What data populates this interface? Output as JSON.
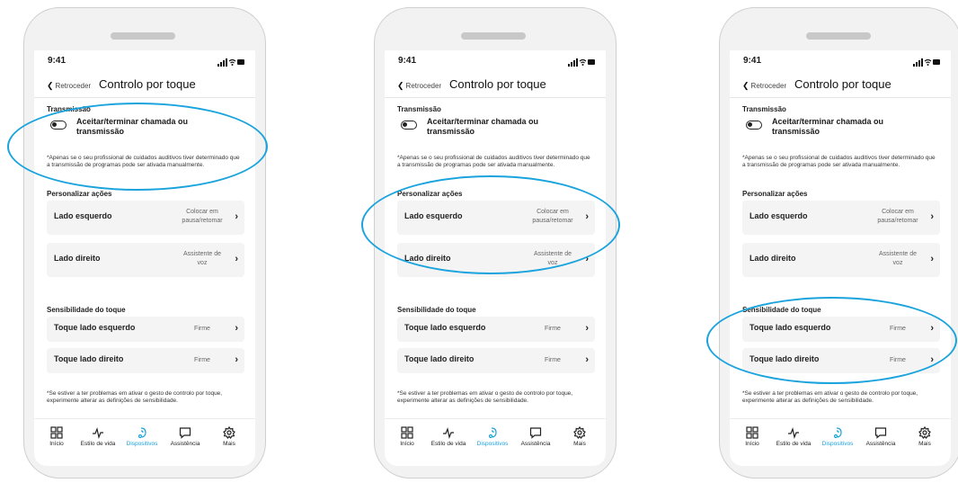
{
  "accent_color": "#1aa3dd",
  "status": {
    "time": "9:41"
  },
  "header": {
    "back_label": "Retroceder",
    "title": "Controlo por toque"
  },
  "transmission": {
    "section_title": "Transmissão",
    "toggle_label": "Aceitar/terminar chamada ou transmissão",
    "note": "*Apenas se o seu profissional de cuidados auditivos tiver determinado que a transmissão de programas pode ser ativada manualmente."
  },
  "actions": {
    "section_title": "Personalizar ações",
    "left_label": "Lado esquerdo",
    "left_value": "Colocar em pausa/retomar",
    "right_label": "Lado direito",
    "right_value": "Assistente de voz"
  },
  "sensitivity": {
    "section_title": "Sensibilidade do toque",
    "left_label": "Toque lado esquerdo",
    "left_value": "Firme",
    "right_label": "Toque lado direito",
    "right_value": "Firme",
    "note": "*Se estiver a ter problemas em ativar o gesto de controlo por toque, experimente alterar as definições de sensibilidade."
  },
  "tabs": [
    {
      "label": "Início",
      "icon": "grid-icon"
    },
    {
      "label": "Estilo de vida",
      "icon": "activity-icon"
    },
    {
      "label": "Dispositivos",
      "icon": "hearing-aid-icon",
      "active": true
    },
    {
      "label": "Assistência",
      "icon": "chat-icon"
    },
    {
      "label": "Mais",
      "icon": "gear-icon"
    }
  ]
}
